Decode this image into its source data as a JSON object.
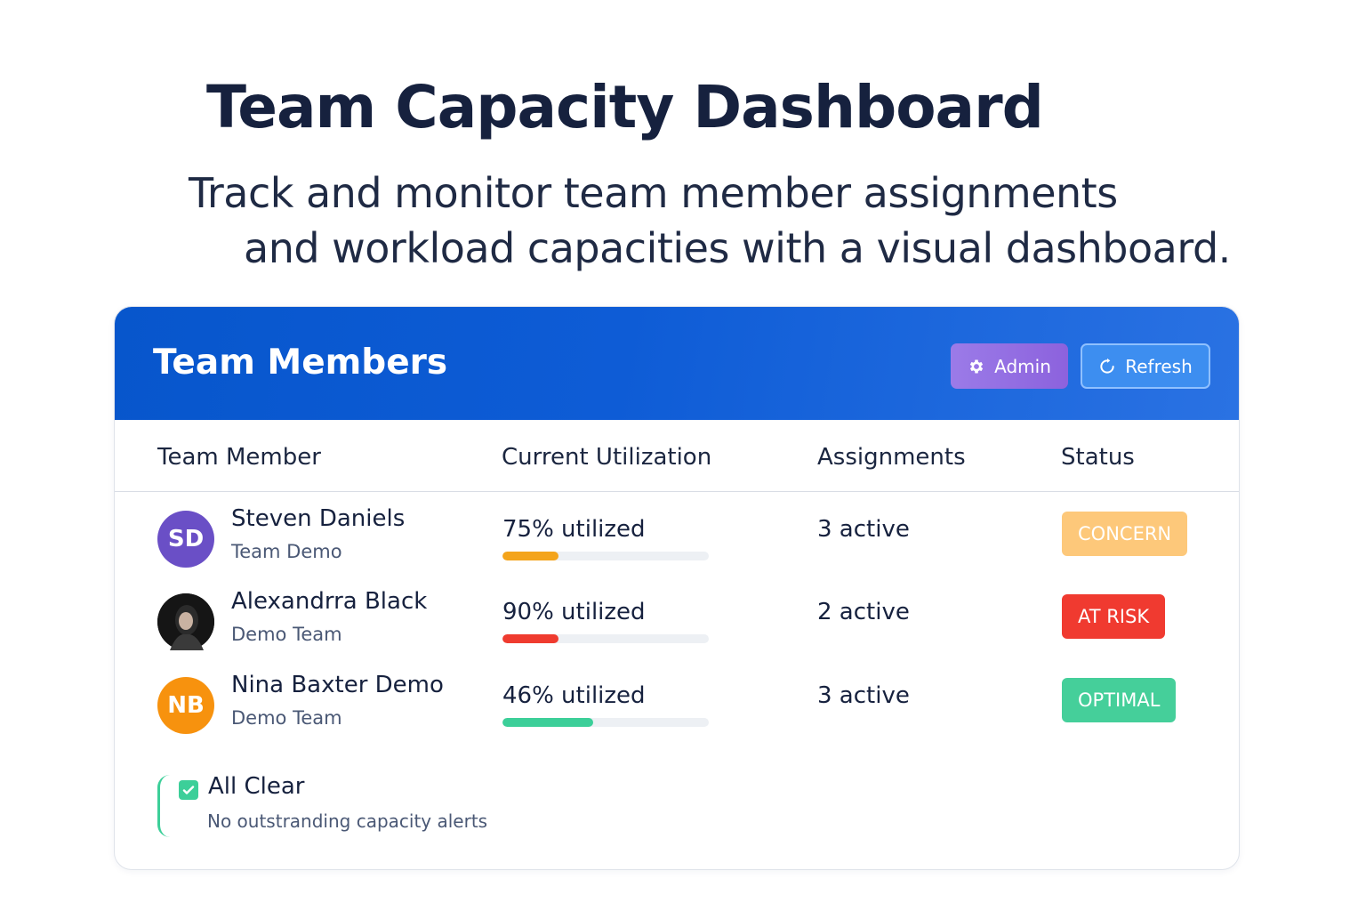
{
  "page": {
    "title": "Team Capacity Dashboard",
    "subtitle_line1": "Track and monitor team member assignments",
    "subtitle_line2": "and workload capacities with a visual dashboard."
  },
  "card": {
    "title": "Team Members",
    "admin_label": "Admin",
    "refresh_label": "Refresh",
    "admin_icon": "gear-icon",
    "refresh_icon": "refresh-icon",
    "header_color": "#0756cc"
  },
  "table": {
    "columns": [
      "Team Member",
      "Current Utilization",
      "Assignments",
      "Status"
    ],
    "rows": [
      {
        "initials": "SD",
        "avatar_color": "#6a4fc6",
        "name": "Steven Daniels",
        "team": "Team Demo",
        "utilization_text": "75% utilized",
        "utilization_fill": 0.27,
        "bar_color": "#f4a41b",
        "assignments": "3 active",
        "status": "CONCERN",
        "status_color": "#fdc87a"
      },
      {
        "initials": "",
        "avatar_color": "#222222",
        "avatar_type": "photo",
        "name": "Alexandrra Black",
        "team": "Demo Team",
        "utilization_text": "90% utilized",
        "utilization_fill": 0.27,
        "bar_color": "#ef3b2f",
        "assignments": "2 active",
        "status": "AT RISK",
        "status_color": "#f03a30"
      },
      {
        "initials": "NB",
        "avatar_color": "#f7920e",
        "name": "Nina Baxter Demo",
        "team": "Demo Team",
        "utilization_text": "46% utilized",
        "utilization_fill": 0.44,
        "bar_color": "#3ccf99",
        "assignments": "3 active",
        "status": "OPTIMAL",
        "status_color": "#45cf9a"
      }
    ]
  },
  "alert": {
    "title": "All Clear",
    "message": "No outstranding capacity alerts",
    "icon": "checkbox-icon",
    "color": "#3ccf99"
  }
}
